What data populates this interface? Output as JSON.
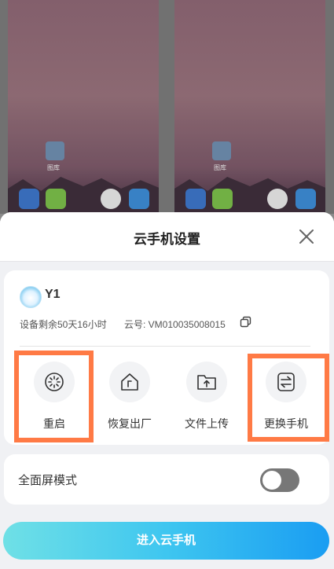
{
  "background": {
    "gallery_label": "图库"
  },
  "sheet": {
    "title": "云手机设置"
  },
  "device": {
    "name": "Y1",
    "remaining": "设备剩余50天16小时",
    "cloud_id": "云号: VM010035008015"
  },
  "actions": [
    {
      "label": "重启",
      "icon": "restart-icon"
    },
    {
      "label": "恢复出厂",
      "icon": "factory-reset-icon"
    },
    {
      "label": "文件上传",
      "icon": "upload-folder-icon"
    },
    {
      "label": "更换手机",
      "icon": "switch-phone-icon"
    }
  ],
  "fullscreen": {
    "label": "全面屏模式",
    "enabled": false
  },
  "enter_button": "进入云手机",
  "colors": {
    "highlight": "#ff7a45",
    "toggle_off": "#777777",
    "button_gradient_start": "#6fe0e6",
    "button_gradient_end": "#1a9df2"
  }
}
